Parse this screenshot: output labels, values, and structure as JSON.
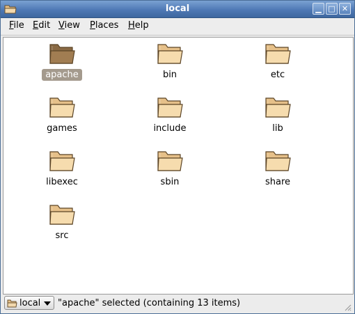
{
  "window": {
    "title": "local"
  },
  "titlebar_buttons": {
    "minimize": "▁",
    "maximize": "□",
    "close": "✕"
  },
  "menu": [
    {
      "label_first": "F",
      "label_rest": "ile"
    },
    {
      "label_first": "E",
      "label_rest": "dit"
    },
    {
      "label_first": "V",
      "label_rest": "iew"
    },
    {
      "label_first": "P",
      "label_rest": "laces"
    },
    {
      "label_first": "H",
      "label_rest": "elp"
    }
  ],
  "folders": [
    {
      "name": "apache",
      "selected": true
    },
    {
      "name": "bin",
      "selected": false
    },
    {
      "name": "etc",
      "selected": false
    },
    {
      "name": "games",
      "selected": false
    },
    {
      "name": "include",
      "selected": false
    },
    {
      "name": "lib",
      "selected": false
    },
    {
      "name": "libexec",
      "selected": false
    },
    {
      "name": "sbin",
      "selected": false
    },
    {
      "name": "share",
      "selected": false
    },
    {
      "name": "src",
      "selected": false
    }
  ],
  "statusbar": {
    "location": "local",
    "status": "\"apache\" selected (containing 13 items)"
  },
  "colors": {
    "titlebar": "#4f79b5",
    "folder": "#e6c089",
    "folder_selected": "#8a6a44",
    "selection": "#a49a8d"
  }
}
